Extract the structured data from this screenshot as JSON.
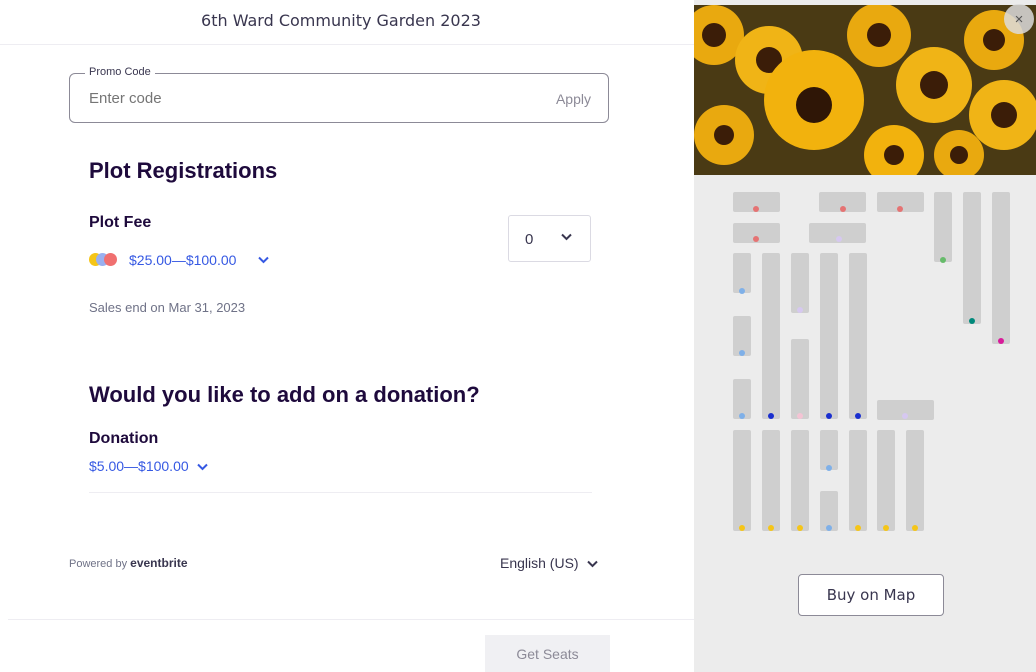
{
  "header": {
    "title": "6th Ward Community Garden 2023"
  },
  "promo": {
    "label": "Promo Code",
    "placeholder": "Enter code",
    "apply_label": "Apply"
  },
  "plot_section": {
    "title": "Plot Registrations",
    "ticket_name": "Plot Fee",
    "price_range": "$25.00—$100.00",
    "quantity": "0",
    "sales_end": "Sales end on Mar 31, 2023",
    "legend_colors": [
      "#f5c518",
      "#9ab0f0",
      "#f07070"
    ]
  },
  "donation_section": {
    "title": "Would you like to add on a donation?",
    "ticket_name": "Donation",
    "price_range": "$5.00—$100.00"
  },
  "footer": {
    "powered_by": "Powered by",
    "brand": "eventbrite",
    "language": "English (US)",
    "get_seats_label": "Get Seats"
  },
  "map": {
    "close_icon": "×",
    "buy_on_map_label": "Buy on Map",
    "plot_dot_colors": [
      "#e57373",
      "#d6c8f0",
      "#66bb6a",
      "#00897b",
      "#d81b9a",
      "#7fb0e8",
      "#1a2fcf",
      "#f4c4d4",
      "#f5c518"
    ]
  }
}
